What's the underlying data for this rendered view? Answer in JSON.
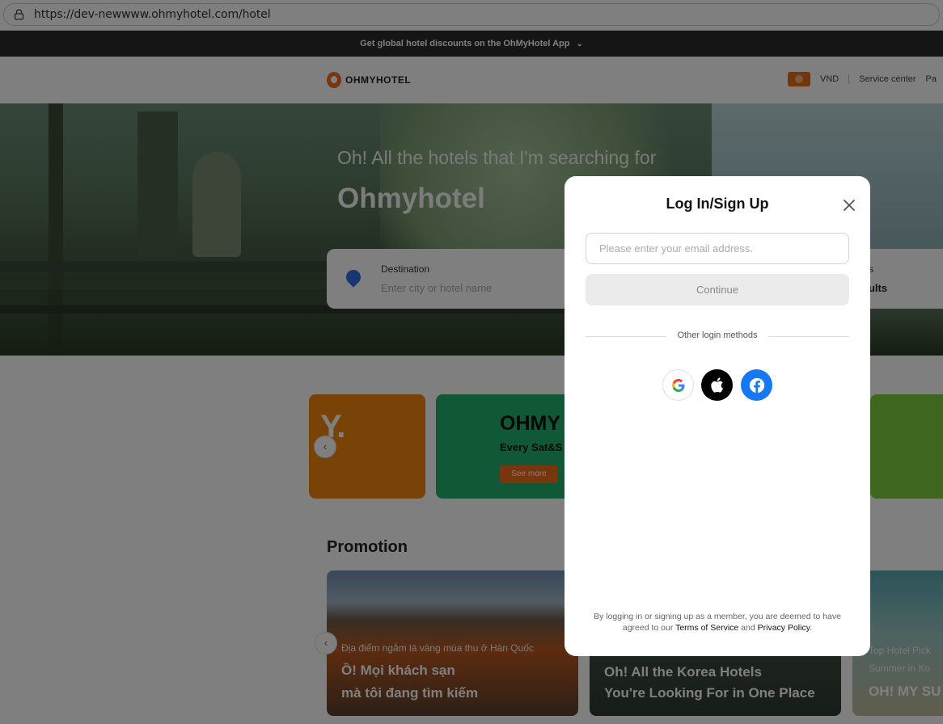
{
  "browser": {
    "url": "https://dev-newwww.ohmyhotel.com/hotel"
  },
  "promo_bar": {
    "text": "Get global hotel discounts on the OhMyHotel App"
  },
  "header": {
    "logo": "OHMYHOTEL",
    "currency": "VND",
    "service_center": "Service center",
    "more": "Pa"
  },
  "hero": {
    "subtitle": "Oh! All the hotels that I'm searching for",
    "title": "Ohmyhotel"
  },
  "search": {
    "destination_label": "Destination",
    "destination_placeholder": "Enter city or hotel name",
    "guests_label": "s",
    "guests_value": "dults"
  },
  "banners": {
    "b1_text": "Y.",
    "b2_title": "OHMY",
    "b2_sub": "Every Sat&S",
    "b2_button": "See more"
  },
  "promotion": {
    "title": "Promotion",
    "cards": [
      {
        "small": "Địa điểm ngắm lá vàng mùa thu ở Hàn Quốc",
        "line1": "Ồ! Mọi khách sạn",
        "line2": "mà tôi đang tìm kiếm"
      },
      {
        "small": "",
        "line1": "Oh! All the Korea Hotels",
        "line2": "You're Looking For in One Place"
      },
      {
        "small": "Top Hotel Pick",
        "line0": "Summer in Ko",
        "line1": "OH! MY SU"
      }
    ]
  },
  "modal": {
    "title": "Log In/Sign Up",
    "email_placeholder": "Please enter your email address.",
    "continue_label": "Continue",
    "other_methods": "Other login methods",
    "terms_prefix": "By logging in or signing up as a member, you are deemed to have agreed to our ",
    "terms_link": "Terms of Service",
    "terms_and": " and ",
    "privacy_link": "Privacy Policy",
    "terms_suffix": "."
  },
  "colors": {
    "brand_orange": "#f26b1a",
    "facebook": "#1877f2",
    "apple": "#000000"
  }
}
